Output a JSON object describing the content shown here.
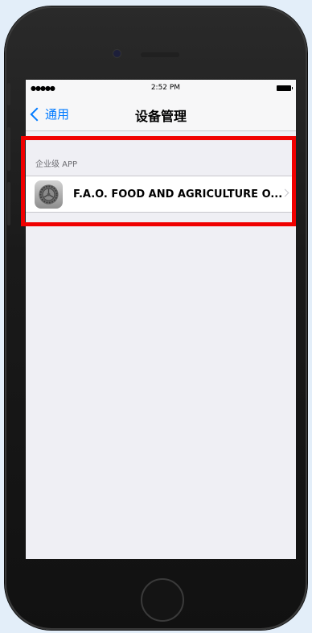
{
  "status_bar": {
    "signal": "●●●●●",
    "time": "2:52 PM"
  },
  "nav": {
    "back_label": "通用",
    "title": "设备管理"
  },
  "section": {
    "header": "企业级 APP",
    "items": [
      {
        "name": "F.A.O. FOOD AND AGRICULTURE O...",
        "icon": "settings-gear-icon"
      }
    ]
  },
  "colors": {
    "accent": "#007aff",
    "highlight": "#f00000",
    "background": "#efeff4"
  }
}
